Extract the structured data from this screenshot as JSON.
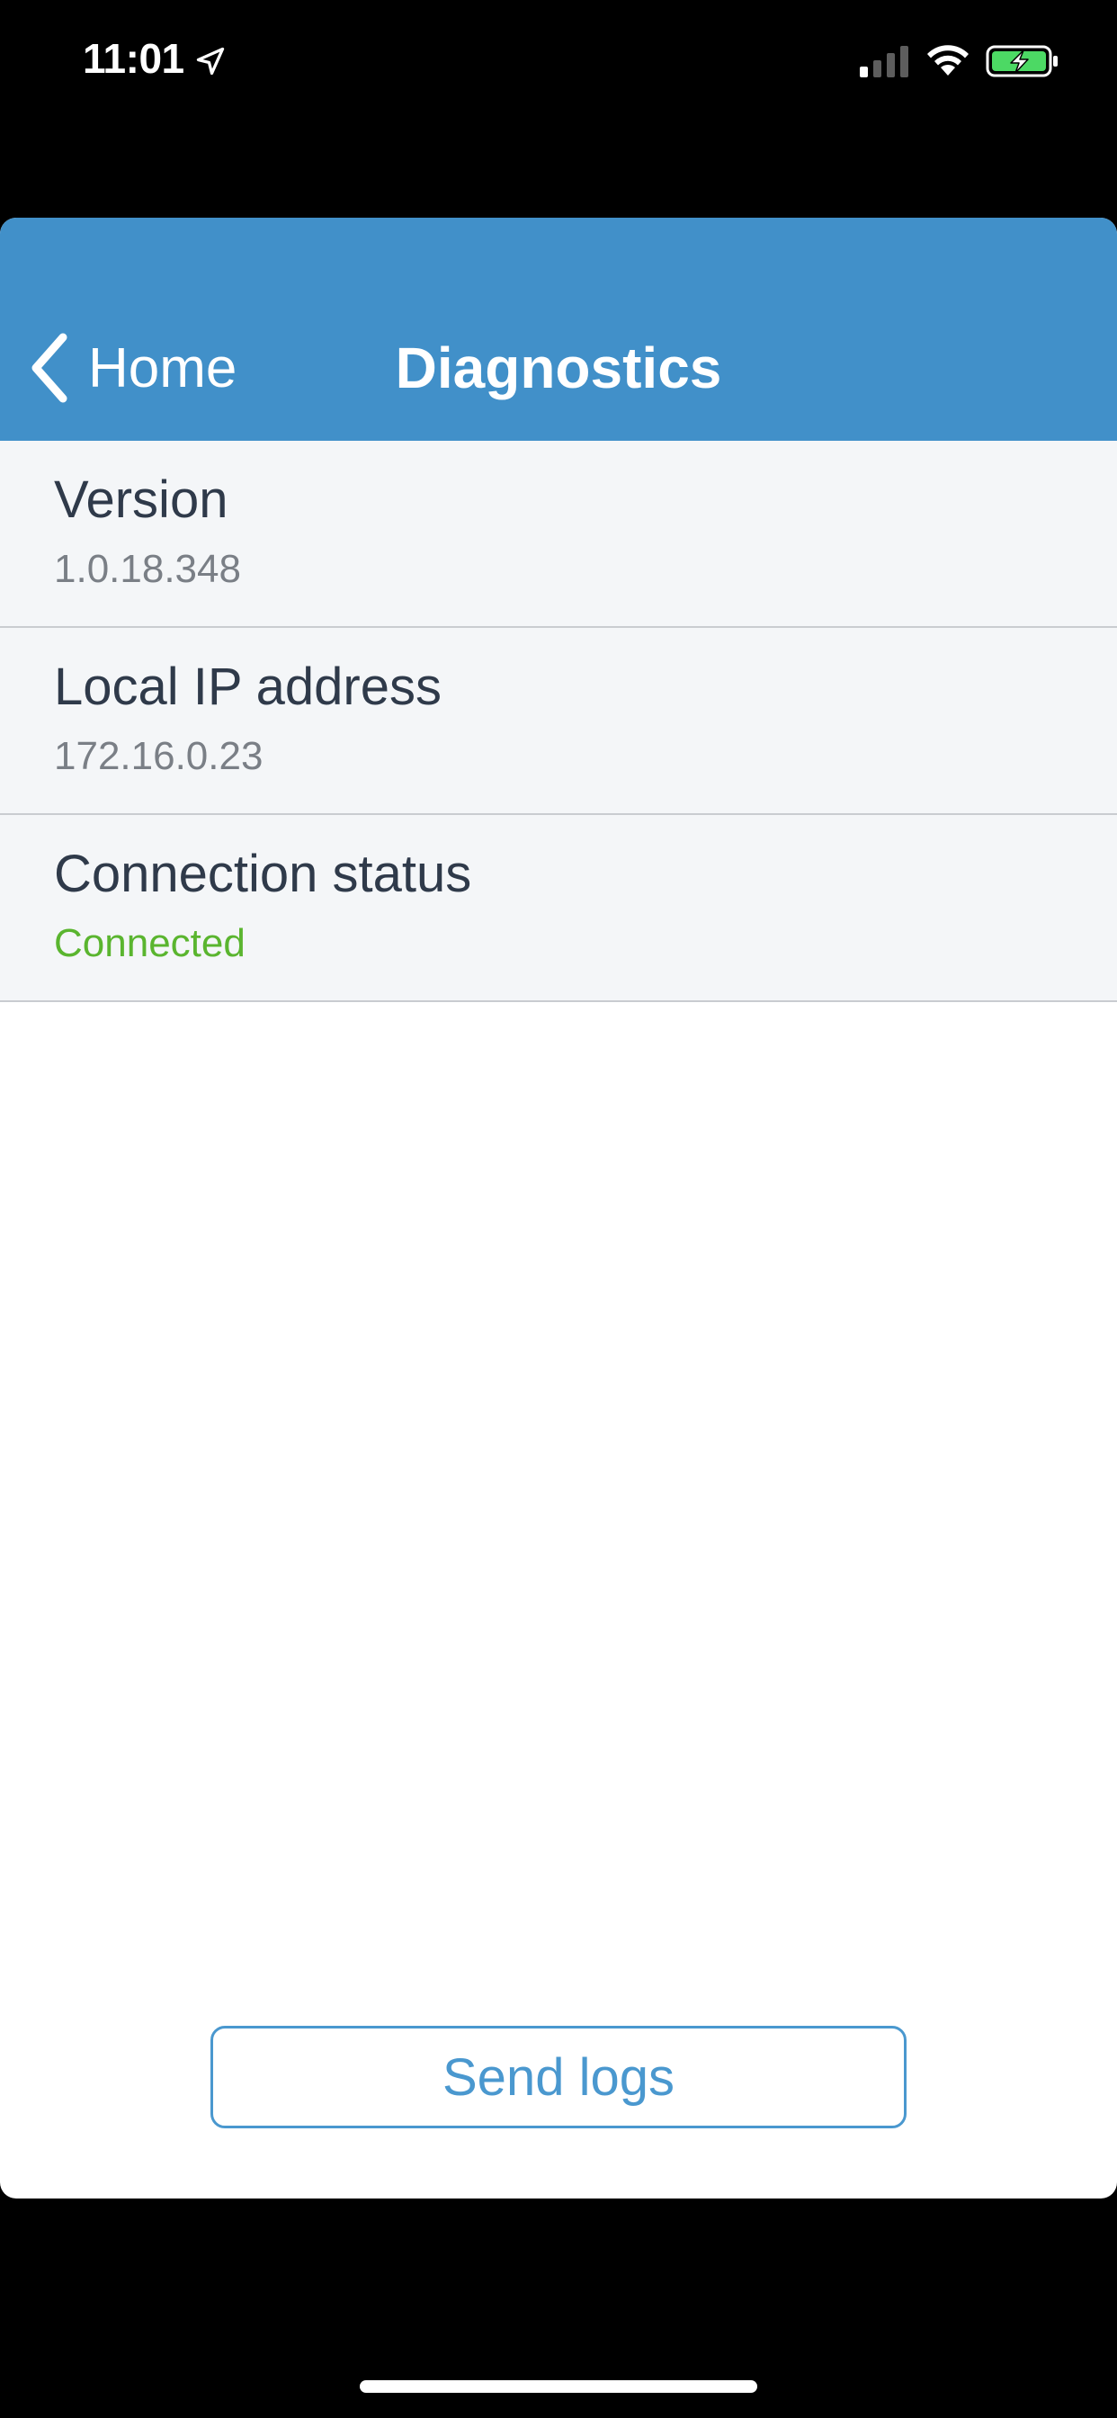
{
  "status_bar": {
    "time": "11:01",
    "icons": [
      "location-arrow-icon",
      "cellular-signal-icon",
      "wifi-icon",
      "battery-charging-icon"
    ],
    "battery_color": "#4cd964"
  },
  "nav": {
    "back_label": "Home",
    "title": "Diagnostics",
    "background_color": "#4190c9"
  },
  "rows": [
    {
      "label": "Version",
      "value": "1.0.18.348"
    },
    {
      "label": "Local IP address",
      "value": "172.16.0.23"
    },
    {
      "label": "Connection status",
      "value": "Connected",
      "value_color": "#5ab52f"
    }
  ],
  "actions": {
    "send_logs_label": "Send logs"
  }
}
